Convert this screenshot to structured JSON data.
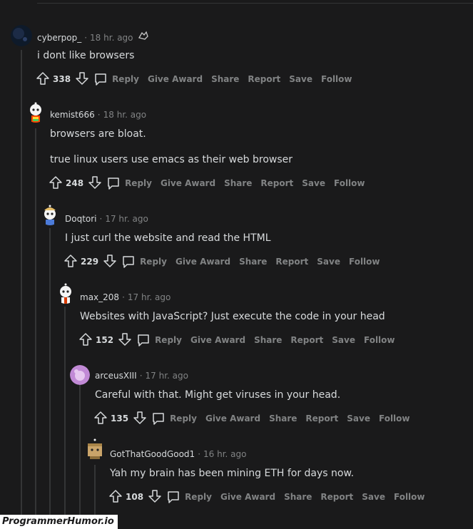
{
  "comments": [
    {
      "author": "cyberpop_",
      "time": "18 hr. ago",
      "body": [
        "i dont like browsers"
      ],
      "score": "338",
      "avatar_icon": "dark-planet-avatar"
    },
    {
      "author": "kemist666",
      "time": "18 hr. ago",
      "body": [
        "browsers are bloat.",
        "true linux users use emacs as their web browser"
      ],
      "score": "248",
      "avatar_icon": "snoo-rainbow-avatar"
    },
    {
      "author": "Doqtori",
      "time": "17 hr. ago",
      "body": [
        "I just curl the website and read the HTML"
      ],
      "score": "229",
      "avatar_icon": "snoo-blue-avatar"
    },
    {
      "author": "max_208",
      "time": "17 hr. ago",
      "body": [
        "Websites with JavaScript? Just execute the code in your head"
      ],
      "score": "152",
      "avatar_icon": "snoo-red-avatar"
    },
    {
      "author": "arceusXIII",
      "time": "17 hr. ago",
      "body": [
        "Careful with that. Might get viruses in your head."
      ],
      "score": "135",
      "avatar_icon": "default-purple-avatar"
    },
    {
      "author": "GotThatGoodGood1",
      "time": "16 hr. ago",
      "body": [
        "Yah my brain has been mining ETH for days now."
      ],
      "score": "108",
      "avatar_icon": "snoo-box-avatar"
    }
  ],
  "actions": {
    "reply": "Reply",
    "give_award": "Give Award",
    "share": "Share",
    "report": "Report",
    "save": "Save",
    "follow": "Follow"
  },
  "watermark": "ProgrammerHumor.io",
  "colors": {
    "background": "#1a1a1b",
    "text": "#d7dadc",
    "muted": "#818384",
    "thread_line": "#343536"
  }
}
